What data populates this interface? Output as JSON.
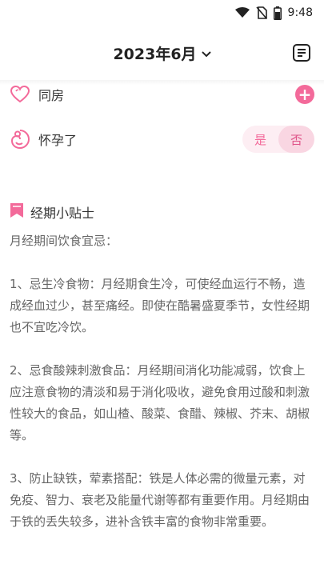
{
  "status_bar": {
    "time": "9:48",
    "icons": [
      "wifi-icon",
      "no-sim-icon",
      "battery-icon"
    ]
  },
  "header": {
    "month_title": "2023年6月",
    "dropdown_icon": "chevron-down-icon",
    "notes_icon": "notes-icon"
  },
  "records": {
    "intimacy": {
      "label": "同房",
      "icon": "heart-outline-icon",
      "add_label": "+"
    },
    "pregnant": {
      "label": "怀孕了",
      "icon": "fetus-icon",
      "options": [
        "是",
        "否"
      ],
      "selected": "否"
    }
  },
  "tips": {
    "icon": "bookmark-icon",
    "title": "经期小贴士",
    "paragraphs": [
      "月经期间饮食宜忌：",
      "1、忌生冷食物：月经期食生冷，可使经血运行不畅，造成经血过少，甚至痛经。即使在酷暑盛夏季节，女性经期也不宜吃冷饮。",
      "2、忌食酸辣刺激食品：月经期间消化功能减弱，饮食上应注意食物的清淡和易于消化吸收，避免食用过酸和刺激性较大的食品，如山楂、酸菜、食醋、辣椒、芥末、胡椒等。",
      "3、防止缺铁，荤素搭配：铁是人体必需的微量元素，对免疫、智力、衰老及能量代谢等都有重要作用。月经期由于铁的丢失较多，进补含铁丰富的食物非常重要。"
    ]
  },
  "colors": {
    "accent_pink": "#f36a9a",
    "toggle_bg": "#fdeef3",
    "toggle_selected": "#f9d6e2"
  }
}
